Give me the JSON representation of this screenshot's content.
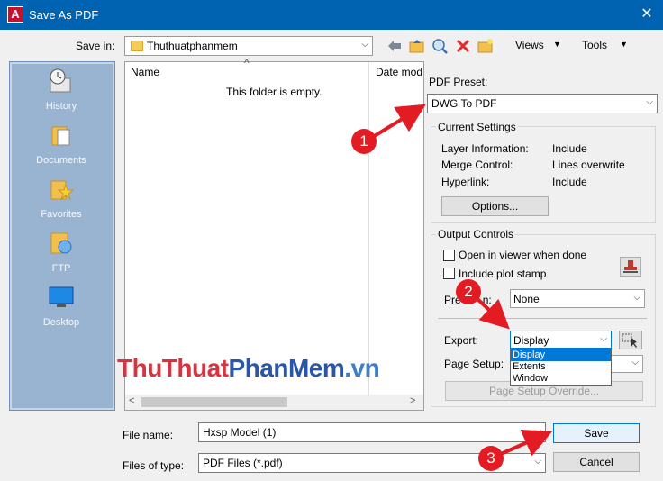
{
  "window": {
    "title": "Save As PDF",
    "app_icon_letter": "A",
    "close_glyph": "✕"
  },
  "toolbar": {
    "save_in_label": "Save in:",
    "save_in_value": "Thuthuatphanmem",
    "views_label": "Views",
    "tools_label": "Tools",
    "menu_arrow": "▼"
  },
  "places": [
    "History",
    "Documents",
    "Favorites",
    "FTP",
    "Desktop"
  ],
  "file_list": {
    "col_name": "Name",
    "col_date": "Date mod",
    "empty_message": "This folder is empty.",
    "sort_caret": "^"
  },
  "preset": {
    "label": "PDF Preset:",
    "value": "DWG To PDF"
  },
  "current_settings": {
    "title": "Current Settings",
    "layer_label": "Layer Information:",
    "layer_value": "Include",
    "merge_label": "Merge Control:",
    "merge_value": "Lines overwrite",
    "hyperlink_label": "Hyperlink:",
    "hyperlink_value": "Include",
    "options_button": "Options..."
  },
  "output_controls": {
    "title": "Output Controls",
    "open_viewer_label": "Open in viewer when done",
    "plot_stamp_label": "Include plot stamp",
    "precision_label": "Pre",
    "precision_label_tail": "n:",
    "precision_value": "None",
    "export_label": "Export:",
    "export_value": "Display",
    "export_options": [
      "Display",
      "Extents",
      "Window"
    ],
    "page_setup_label": "Page Setup:",
    "page_setup_override": "Page Setup Override..."
  },
  "bottom": {
    "file_name_label": "File name:",
    "file_name_value": "Hxsp Model (1)",
    "file_type_label": "Files of type:",
    "file_type_value": "PDF Files (*.pdf)",
    "save_button": "Save",
    "cancel_button": "Cancel"
  },
  "watermark": {
    "part1": "ThuThuat",
    "part2": "PhanMem",
    "part3": ".vn"
  },
  "annotations": {
    "badge1": "1",
    "badge2": "2",
    "badge3": "3"
  },
  "colors": {
    "titlebar": "#0063b1",
    "accent": "#0078d7",
    "annotation": "#e31b23"
  }
}
